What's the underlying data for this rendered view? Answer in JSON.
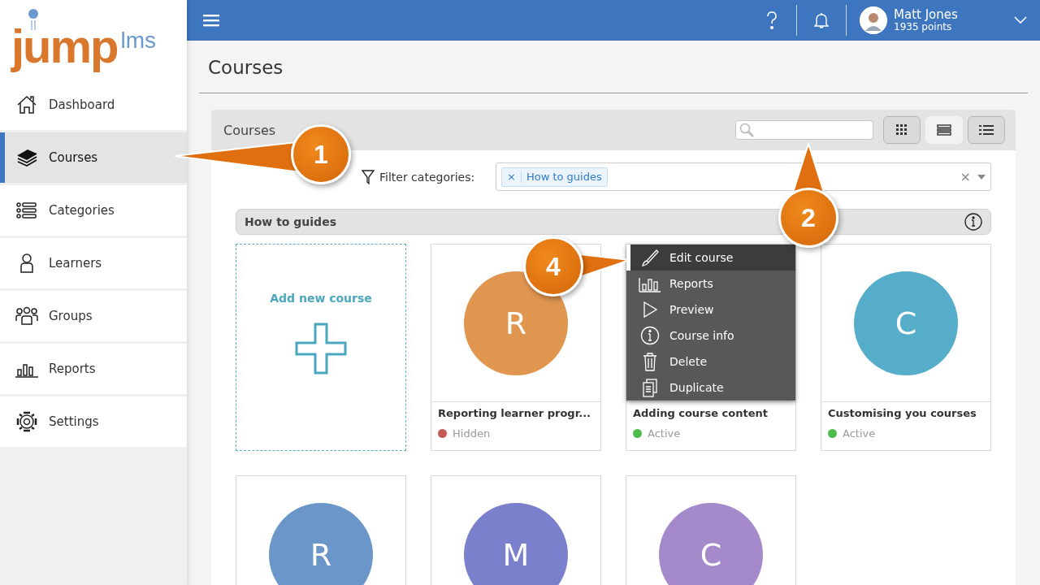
{
  "logo": {
    "primary": "jump",
    "secondary": "lms"
  },
  "sidebar": {
    "items": [
      {
        "label": "Dashboard",
        "selected": false
      },
      {
        "label": "Courses",
        "selected": true
      },
      {
        "label": "Categories",
        "selected": false
      },
      {
        "label": "Learners",
        "selected": false
      },
      {
        "label": "Groups",
        "selected": false
      },
      {
        "label": "Reports",
        "selected": false
      },
      {
        "label": "Settings",
        "selected": false
      }
    ]
  },
  "topbar": {
    "user": {
      "name": "Matt Jones",
      "points": "1935 points"
    }
  },
  "page_title": "Courses",
  "panel": {
    "title": "Courses",
    "view_buttons": [
      {
        "selected": false
      },
      {
        "selected": true
      },
      {
        "selected": false
      }
    ],
    "filter": {
      "label": "Filter categories:",
      "tags": [
        {
          "label": "How to guides",
          "remove": "×"
        }
      ],
      "clear": "×"
    },
    "section": {
      "title": "How to guides"
    },
    "add_card": {
      "label": "Add new course"
    },
    "courses": [
      {
        "initial": "R",
        "color": "#e0964f",
        "title": "Reporting learner progr...",
        "status": {
          "label": "Hidden",
          "color": "#c25a55"
        },
        "menu_open": false
      },
      {
        "title": "Adding course content",
        "status": {
          "label": "Active",
          "color": "#4cbb47"
        },
        "menu_open": true
      },
      {
        "initial": "C",
        "color": "#56adc9",
        "title": "Customising you courses",
        "status": {
          "label": "Active",
          "color": "#4cbb47"
        },
        "menu_open": false
      },
      {
        "initial": "R",
        "color": "#6a96c9",
        "menu_open": false
      },
      {
        "initial": "M",
        "color": "#7a80cc",
        "menu_open": false
      },
      {
        "initial": "C",
        "color": "#a48acb",
        "menu_open": false
      }
    ]
  },
  "context_menu": {
    "items": [
      {
        "label": "Edit course",
        "selected": true
      },
      {
        "label": "Reports",
        "selected": false
      },
      {
        "label": "Preview",
        "selected": false
      },
      {
        "label": "Course info",
        "selected": false
      },
      {
        "label": "Delete",
        "selected": false
      },
      {
        "label": "Duplicate",
        "selected": false
      }
    ]
  },
  "callouts": [
    {
      "number": "1"
    },
    {
      "number": "2"
    },
    {
      "number": "4"
    }
  ]
}
